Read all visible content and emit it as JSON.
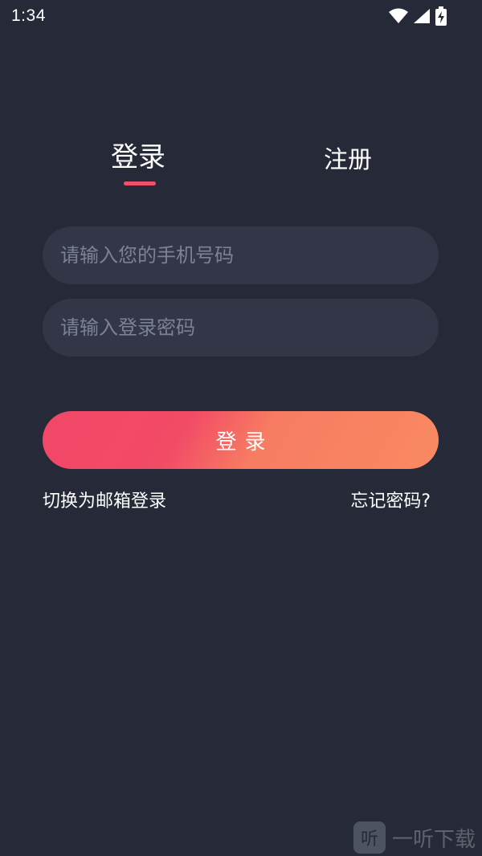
{
  "status_bar": {
    "time": "1:34",
    "icons": [
      "wifi-icon",
      "cellular-signal-icon",
      "battery-charging-icon"
    ]
  },
  "tabs": [
    {
      "label": "登录",
      "active": true
    },
    {
      "label": "注册",
      "active": false
    }
  ],
  "form": {
    "phone_placeholder": "请输入您的手机号码",
    "password_placeholder": "请输入登录密码",
    "login_label": "登录"
  },
  "links": {
    "switch_email": "切换为邮箱登录",
    "forgot_password": "忘记密码?"
  },
  "watermark": {
    "logo_char": "听",
    "text": "一听下载"
  },
  "colors": {
    "background": "#262a38",
    "input_bg": "#323647",
    "accent": "#f0506b",
    "button_start": "#f24768",
    "button_end": "#f98a62"
  }
}
